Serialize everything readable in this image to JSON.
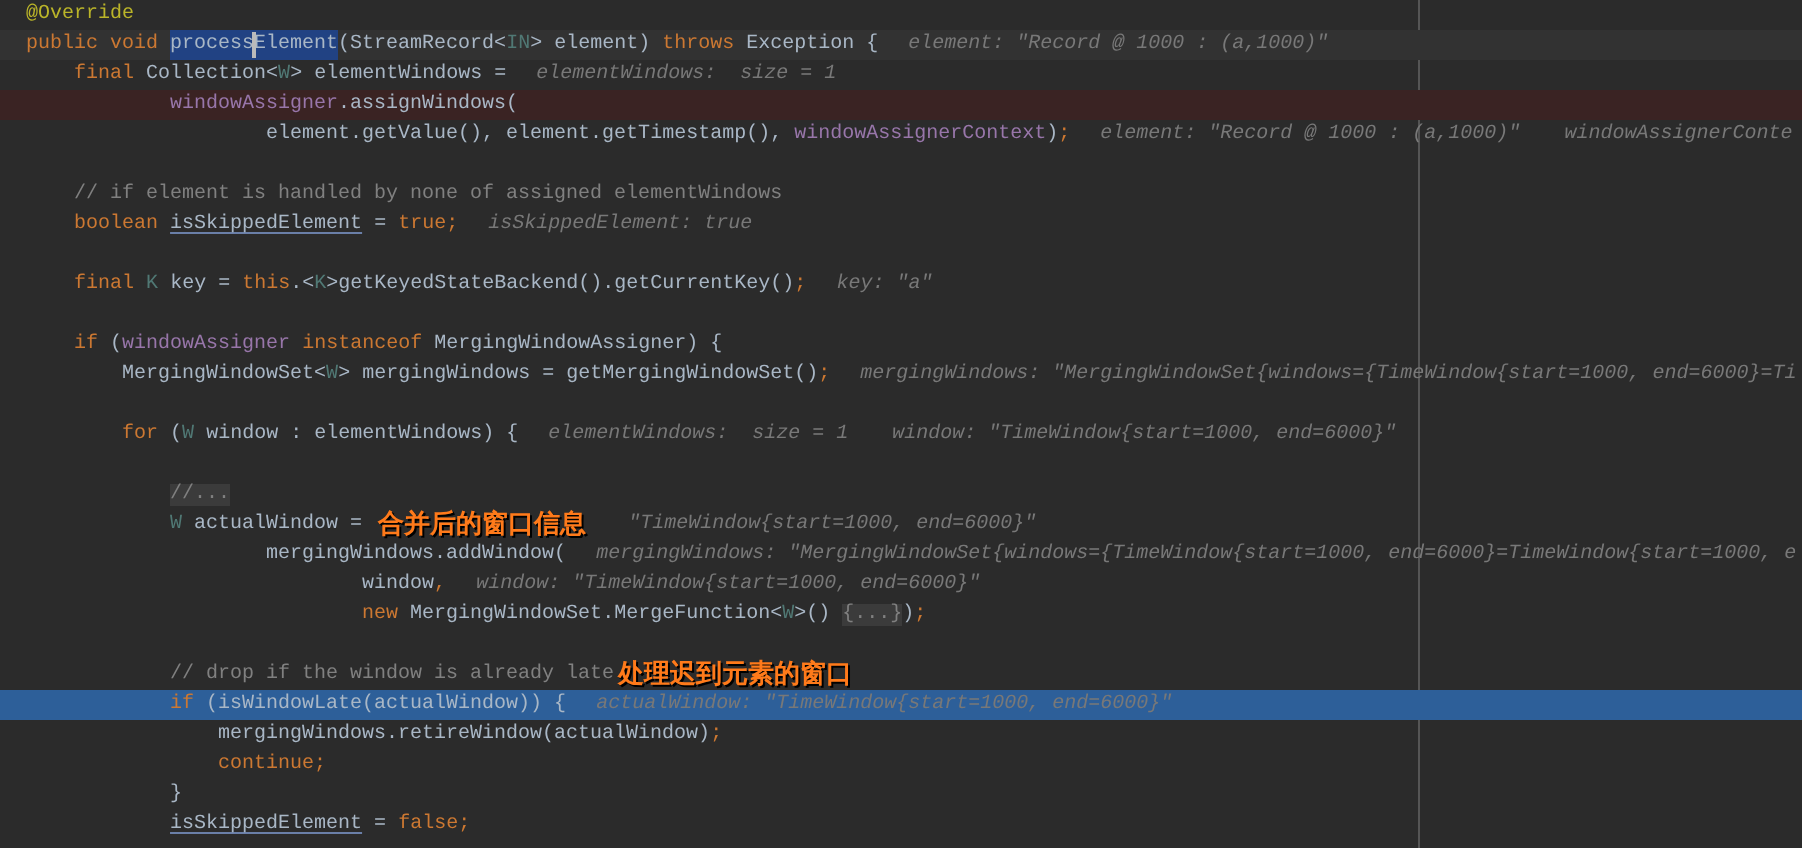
{
  "lines": [
    {
      "kind": "none",
      "tokens": [
        {
          "kind": "annotation",
          "text": "@Override"
        }
      ]
    },
    {
      "kind": "caret-line",
      "tokens": [
        {
          "kind": "keyword",
          "text": "public void "
        },
        {
          "kind": "selected",
          "text": "process"
        },
        {
          "kind": "caret"
        },
        {
          "kind": "selected",
          "text": "Element"
        },
        {
          "kind": "plain",
          "text": "(StreamRecord<"
        },
        {
          "kind": "type",
          "text": "IN"
        },
        {
          "kind": "plain",
          "text": "> element) "
        },
        {
          "kind": "keyword",
          "text": "throws "
        },
        {
          "kind": "plain",
          "text": "Exception {"
        }
      ],
      "hints": [
        "element: \"Record @ 1000 : (a,1000)\""
      ]
    },
    {
      "kind": "none",
      "tokens": [
        {
          "kind": "keyword",
          "text": "    final "
        },
        {
          "kind": "plain",
          "text": "Collection<"
        },
        {
          "kind": "type",
          "text": "W"
        },
        {
          "kind": "plain",
          "text": "> elementWindows ="
        }
      ],
      "hints": [
        "elementWindows:  size = 1"
      ]
    },
    {
      "kind": "breakpoint",
      "tokens": [
        {
          "kind": "field",
          "text": "            windowAssigner"
        },
        {
          "kind": "plain",
          "text": ".assignWindows("
        }
      ]
    },
    {
      "kind": "none",
      "tokens": [
        {
          "kind": "plain",
          "text": "                    element.getValue(), element.getTimestamp(), "
        },
        {
          "kind": "field",
          "text": "windowAssignerContext"
        },
        {
          "kind": "plain",
          "text": ")"
        },
        {
          "kind": "keyword",
          "text": ";"
        }
      ],
      "hints": [
        "element: \"Record @ 1000 : (a,1000)\"",
        "windowAssignerConte"
      ]
    },
    {
      "kind": "none"
    },
    {
      "kind": "none",
      "tokens": [
        {
          "kind": "comment",
          "text": "    // if element is handled by none of assigned elementWindows"
        }
      ]
    },
    {
      "kind": "none",
      "tokens": [
        {
          "kind": "keyword",
          "text": "    boolean "
        },
        {
          "kind": "underline",
          "text": "isSkippedElement"
        },
        {
          "kind": "plain",
          "text": " = "
        },
        {
          "kind": "keyword",
          "text": "true;"
        }
      ],
      "hints": [
        "isSkippedElement: true"
      ]
    },
    {
      "kind": "none"
    },
    {
      "kind": "none",
      "tokens": [
        {
          "kind": "keyword",
          "text": "    final "
        },
        {
          "kind": "type",
          "text": "K"
        },
        {
          "kind": "plain",
          "text": " key = "
        },
        {
          "kind": "keyword",
          "text": "this"
        },
        {
          "kind": "plain",
          "text": ".<"
        },
        {
          "kind": "type",
          "text": "K"
        },
        {
          "kind": "plain",
          "text": ">getKeyedStateBackend().getCurrentKey()"
        },
        {
          "kind": "keyword",
          "text": ";"
        }
      ],
      "hints": [
        "key: \"a\""
      ]
    },
    {
      "kind": "none"
    },
    {
      "kind": "none",
      "tokens": [
        {
          "kind": "keyword",
          "text": "    if "
        },
        {
          "kind": "plain",
          "text": "("
        },
        {
          "kind": "field",
          "text": "windowAssigner "
        },
        {
          "kind": "keyword",
          "text": "instanceof "
        },
        {
          "kind": "plain",
          "text": "MergingWindowAssigner) {"
        }
      ]
    },
    {
      "kind": "none",
      "tokens": [
        {
          "kind": "plain",
          "text": "        MergingWindowSet<"
        },
        {
          "kind": "type",
          "text": "W"
        },
        {
          "kind": "plain",
          "text": "> mergingWindows = getMergingWindowSet()"
        },
        {
          "kind": "keyword",
          "text": ";"
        }
      ],
      "hints": [
        "mergingWindows: \"MergingWindowSet{windows={TimeWindow{start=1000, end=6000}=Ti"
      ]
    },
    {
      "kind": "none"
    },
    {
      "kind": "none",
      "tokens": [
        {
          "kind": "keyword",
          "text": "        for "
        },
        {
          "kind": "plain",
          "text": "("
        },
        {
          "kind": "type",
          "text": "W"
        },
        {
          "kind": "plain",
          "text": " window : elementWindows) {"
        }
      ],
      "hints": [
        "elementWindows:  size = 1",
        "window: \"TimeWindow{start=1000, end=6000}\""
      ]
    },
    {
      "kind": "none"
    },
    {
      "kind": "none",
      "tokens": [
        {
          "kind": "folded",
          "text": "            //..."
        }
      ]
    },
    {
      "kind": "none",
      "tokens": [
        {
          "kind": "type",
          "text": "            W"
        },
        {
          "kind": "plain",
          "text": " actualWindow = "
        },
        {
          "kind": "note",
          "text": "合并后的窗口信息"
        }
      ],
      "hints": [
        "\"TimeWindow{start=1000, end=6000}\""
      ]
    },
    {
      "kind": "none",
      "tokens": [
        {
          "kind": "plain",
          "text": "                    mergingWindows.addWindow("
        }
      ],
      "hints": [
        "mergingWindows: \"MergingWindowSet{windows={TimeWindow{start=1000, end=6000}=TimeWindow{start=1000, e"
      ]
    },
    {
      "kind": "none",
      "tokens": [
        {
          "kind": "plain",
          "text": "                            window"
        },
        {
          "kind": "keyword",
          "text": ","
        }
      ],
      "hints": [
        "window: \"TimeWindow{start=1000, end=6000}\""
      ]
    },
    {
      "kind": "none",
      "tokens": [
        {
          "kind": "keyword",
          "text": "                            new "
        },
        {
          "kind": "plain",
          "text": "MergingWindowSet.MergeFunction<"
        },
        {
          "kind": "type",
          "text": "W"
        },
        {
          "kind": "plain",
          "text": ">() "
        },
        {
          "kind": "folded",
          "text": "{...}"
        },
        {
          "kind": "plain",
          "text": ")"
        },
        {
          "kind": "keyword",
          "text": ";"
        }
      ]
    },
    {
      "kind": "none"
    },
    {
      "kind": "none",
      "tokens": [
        {
          "kind": "comment",
          "text": "            // drop if the window is already late"
        },
        {
          "kind": "note",
          "text": "处理迟到元素的窗口"
        }
      ]
    },
    {
      "kind": "execution",
      "tokens": [
        {
          "kind": "keyword",
          "text": "            if "
        },
        {
          "kind": "plain",
          "text": "(isWindowLate(actualWindow)) {"
        }
      ],
      "hints": [
        "actualWindow: \"TimeWindow{start=1000, end=6000}\""
      ]
    },
    {
      "kind": "none",
      "tokens": [
        {
          "kind": "plain",
          "text": "                mergingWindows.retireWindow(actualWindow)"
        },
        {
          "kind": "keyword",
          "text": ";"
        }
      ]
    },
    {
      "kind": "none",
      "tokens": [
        {
          "kind": "keyword",
          "text": "                continue;"
        }
      ]
    },
    {
      "kind": "none",
      "tokens": [
        {
          "kind": "plain",
          "text": "            }"
        }
      ]
    },
    {
      "kind": "none",
      "tokens": [
        {
          "kind": "underline",
          "text": "            isSkippedElement"
        },
        {
          "kind": "plain",
          "text": " = "
        },
        {
          "kind": "keyword",
          "text": "false;"
        }
      ]
    }
  ]
}
